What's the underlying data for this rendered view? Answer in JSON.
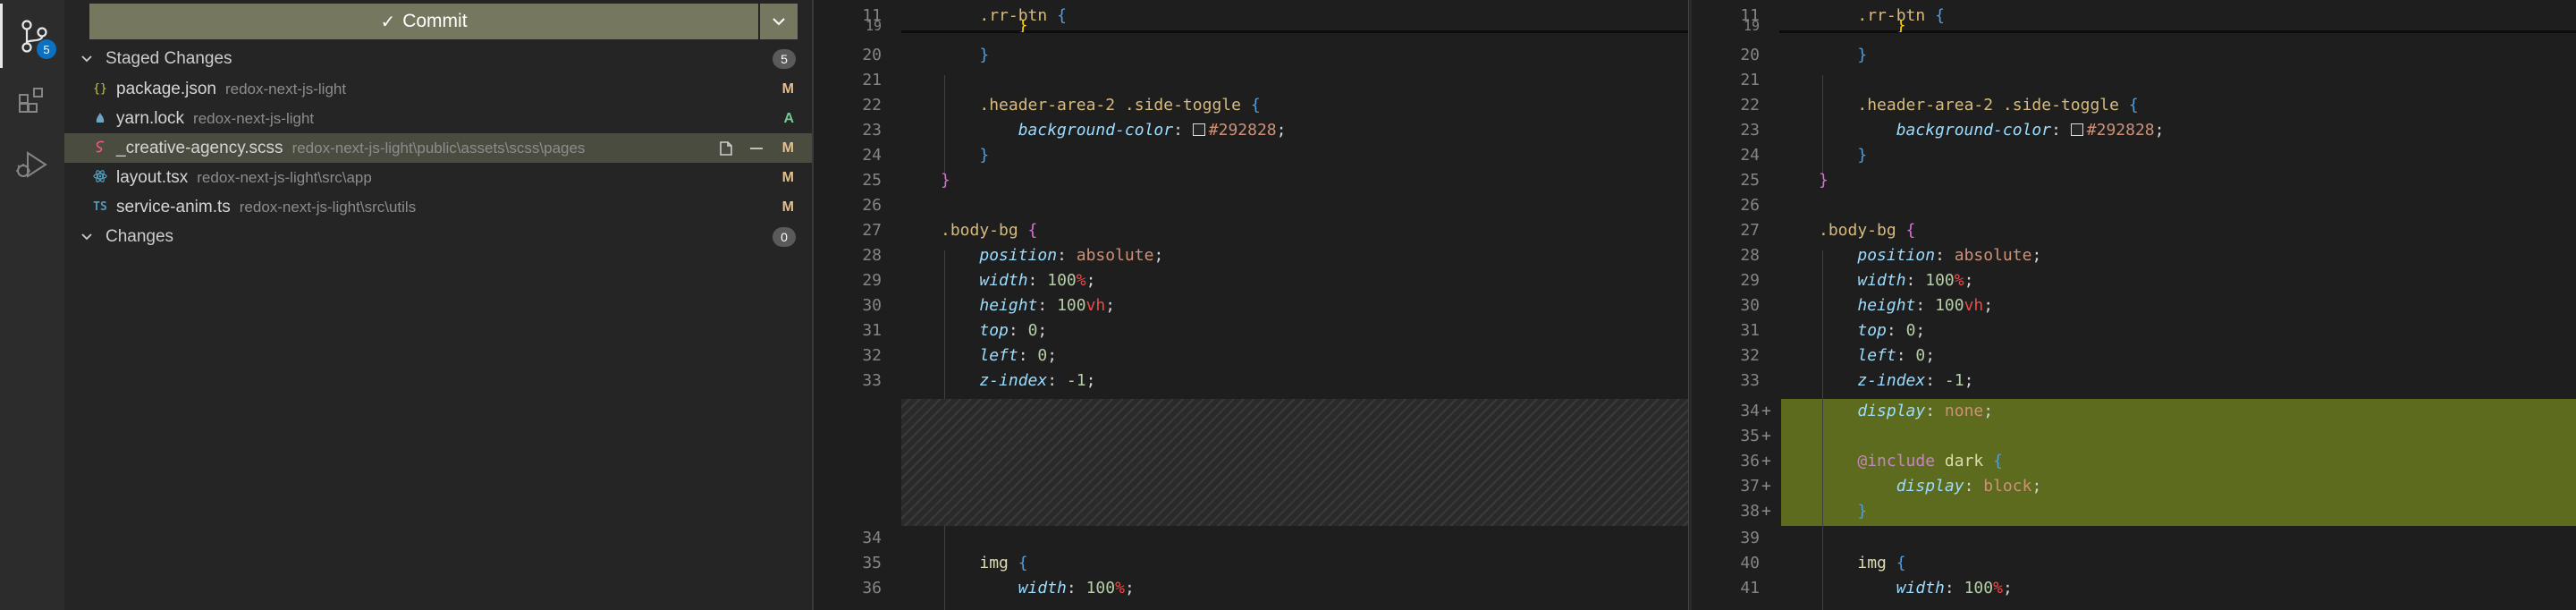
{
  "activity": {
    "scm_badge": "5"
  },
  "scm": {
    "commit_label": "Commit",
    "staged_title": "Staged Changes",
    "staged_count": "5",
    "changes_title": "Changes",
    "changes_count": "0",
    "files": [
      {
        "icon": "{}",
        "name": "package.json",
        "path": "redox-next-js-light",
        "status": "M",
        "status_color": "#e2c08d",
        "icon_color": "#cbcb41"
      },
      {
        "icon": "yarn",
        "name": "yarn.lock",
        "path": "redox-next-js-light",
        "status": "A",
        "status_color": "#73c991",
        "icon_color": "#6fa3c4"
      },
      {
        "icon": "scss",
        "name": "_creative-agency.scss",
        "path": "redox-next-js-light\\public\\assets\\scss\\pages",
        "status": "M",
        "status_color": "#e2c08d",
        "icon_color": "#f55385"
      },
      {
        "icon": "react",
        "name": "layout.tsx",
        "path": "redox-next-js-light\\src\\app",
        "status": "M",
        "status_color": "#e2c08d",
        "icon_color": "#519aba"
      },
      {
        "icon": "TS",
        "name": "service-anim.ts",
        "path": "redox-next-js-light\\src\\utils",
        "status": "M",
        "status_color": "#e2c08d",
        "icon_color": "#519aba"
      }
    ]
  },
  "diff": {
    "left": [
      {
        "n": "11",
        "t": "    .rr-btn {"
      },
      {
        "n": "19",
        "t": "        }"
      },
      {
        "n": "20",
        "t": "    }"
      },
      {
        "n": "21",
        "t": ""
      },
      {
        "n": "22",
        "t": "    .header-area-2 .side-toggle {"
      },
      {
        "n": "23",
        "t": "        background-color: #292828;"
      },
      {
        "n": "24",
        "t": "    }"
      },
      {
        "n": "25",
        "t": "}"
      },
      {
        "n": "26",
        "t": ""
      },
      {
        "n": "27",
        "t": ".body-bg {"
      },
      {
        "n": "28",
        "t": "    position: absolute;"
      },
      {
        "n": "29",
        "t": "    width: 100%;"
      },
      {
        "n": "30",
        "t": "    height: 100vh;"
      },
      {
        "n": "31",
        "t": "    top: 0;"
      },
      {
        "n": "32",
        "t": "    left: 0;"
      },
      {
        "n": "33",
        "t": "    z-index: -1;"
      },
      {
        "n": "34",
        "t": "    img {"
      },
      {
        "n": "35",
        "t": "        width: 100%;"
      }
    ],
    "right": [
      {
        "n": "11",
        "t": "    .rr-btn {"
      },
      {
        "n": "19",
        "t": "        }"
      },
      {
        "n": "20",
        "t": "    }"
      },
      {
        "n": "21",
        "t": ""
      },
      {
        "n": "22",
        "t": "    .header-area-2 .side-toggle {"
      },
      {
        "n": "23",
        "t": "        background-color: #292828;"
      },
      {
        "n": "24",
        "t": "    }"
      },
      {
        "n": "25",
        "t": "}"
      },
      {
        "n": "26",
        "t": ""
      },
      {
        "n": "27",
        "t": ".body-bg {"
      },
      {
        "n": "28",
        "t": "    position: absolute;"
      },
      {
        "n": "29",
        "t": "    width: 100%;"
      },
      {
        "n": "30",
        "t": "    height: 100vh;"
      },
      {
        "n": "31",
        "t": "    top: 0;"
      },
      {
        "n": "32",
        "t": "    left: 0;"
      },
      {
        "n": "33",
        "t": "    z-index: -1;"
      },
      {
        "n": "34",
        "t": "    display: none;"
      },
      {
        "n": "35",
        "t": ""
      },
      {
        "n": "36",
        "t": "    @include dark {"
      },
      {
        "n": "37",
        "t": "        display: block;"
      },
      {
        "n": "38",
        "t": "    }"
      },
      {
        "n": "39",
        "t": ""
      },
      {
        "n": "40",
        "t": "    img {"
      },
      {
        "n": "41",
        "t": "        width: 100%;"
      }
    ],
    "left_extra_line_numbers": [
      "36"
    ]
  }
}
